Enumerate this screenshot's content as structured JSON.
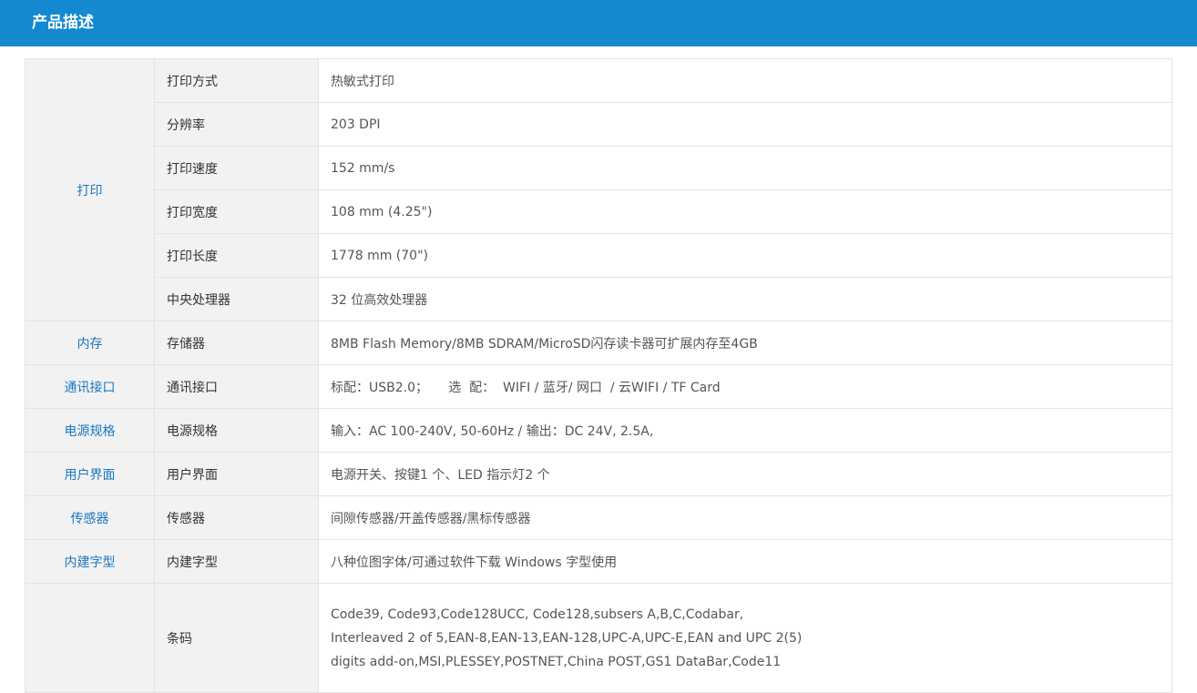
{
  "header": {
    "title": "产品描述"
  },
  "colors": {
    "header_bg": "#1489d0",
    "category_text": "#1a78c2",
    "label_bg": "#f2f2f2",
    "border": "#e3e3e3"
  },
  "spec": {
    "print": {
      "category": "打印",
      "rows": [
        {
          "label": "打印方式",
          "value": "热敏式打印"
        },
        {
          "label": "分辨率",
          "value": "203 DPI"
        },
        {
          "label": "打印速度",
          "value": "152 mm/s"
        },
        {
          "label": "打印宽度",
          "value": "108 mm (4.25\")"
        },
        {
          "label": "打印长度",
          "value": "1778 mm (70\")"
        },
        {
          "label": "中央处理器",
          "value": "32 位高效处理器"
        }
      ]
    },
    "memory": {
      "category": "内存",
      "label": "存储器",
      "value": "8MB Flash Memory/8MB SDRAM/MicroSD闪存读卡器可扩展内存至4GB"
    },
    "interface": {
      "category": "通讯接口",
      "label": "通讯接口",
      "value": "标配：USB2.0；     选  配：  WIFI / 蓝牙/ 网口  / 云WIFI / TF Card"
    },
    "power": {
      "category": "电源规格",
      "label": "电源规格",
      "value": "输入：AC 100-240V, 50-60Hz / 输出：DC 24V, 2.5A,"
    },
    "ui": {
      "category": "用户界面",
      "label": "用户界面",
      "value": "电源开关、按键1 个、LED 指示灯2 个"
    },
    "sensor": {
      "category": "传感器",
      "label": "传感器",
      "value": "间隙传感器/开盖传感器/黑标传感器"
    },
    "fonts": {
      "category": "内建字型",
      "label": "内建字型",
      "value": "八种位图字体/可通过软件下载 Windows 字型使用"
    },
    "barcode": {
      "label": "条码",
      "lines": [
        "Code39, Code93,Code128UCC, Code128,subsers A,B,C,Codabar,",
        "Interleaved 2 of 5,EAN-8,EAN-13,EAN-128,UPC-A,UPC-E,EAN and UPC 2(5)",
        "digits add-on,MSI,PLESSEY,POSTNET,China POST,GS1 DataBar,Code11"
      ]
    }
  }
}
